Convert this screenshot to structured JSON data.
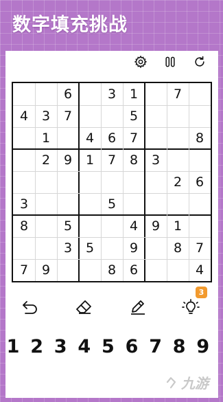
{
  "header": {
    "title": "数字填充挑战"
  },
  "toolbar": {
    "icons": [
      "gear-icon",
      "pause-icon",
      "restart-icon"
    ]
  },
  "board": {
    "rows": [
      [
        "",
        "",
        "6",
        "",
        "3",
        "1",
        "",
        "7",
        ""
      ],
      [
        "4",
        "3",
        "7",
        "",
        "",
        "5",
        "",
        "",
        ""
      ],
      [
        "",
        "1",
        "",
        "4",
        "6",
        "7",
        "",
        "",
        "8"
      ],
      [
        "",
        "2",
        "9",
        "1",
        "7",
        "8",
        "3",
        "",
        ""
      ],
      [
        "",
        "",
        "",
        "",
        "",
        "",
        "",
        "2",
        "6"
      ],
      [
        "3",
        "",
        "",
        "",
        "5",
        "",
        "",
        "",
        ""
      ],
      [
        "8",
        "",
        "5",
        "",
        "",
        "4",
        "9",
        "1",
        ""
      ],
      [
        "",
        "",
        "3",
        "5",
        "",
        "9",
        "",
        "8",
        "7"
      ],
      [
        "7",
        "9",
        "",
        "",
        "8",
        "6",
        "",
        "",
        "4"
      ]
    ]
  },
  "tools": {
    "icons": [
      "undo-icon",
      "eraser-icon",
      "pencil-icon",
      "hint-bulb-icon"
    ],
    "hint_count": "3"
  },
  "numpad": {
    "keys": [
      "1",
      "2",
      "3",
      "4",
      "5",
      "6",
      "7",
      "8",
      "9"
    ]
  },
  "watermark": {
    "text": "九游"
  },
  "colors": {
    "background": "#b477c9",
    "badge": "#f29a2e",
    "text": "#111111"
  }
}
